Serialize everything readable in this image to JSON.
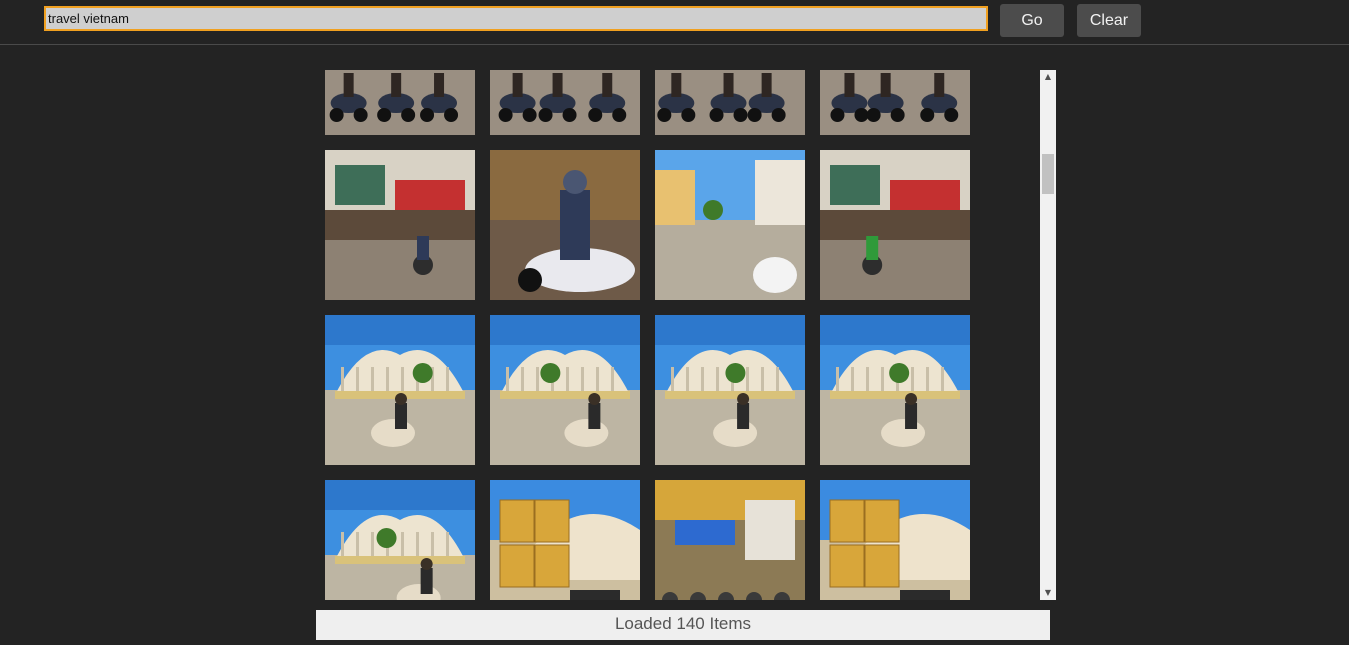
{
  "search": {
    "value": "travel vietnam"
  },
  "toolbar": {
    "go_label": "Go",
    "clear_label": "Clear"
  },
  "gallery": {
    "columns": 4,
    "rows": [
      [
        "street-scooters",
        "street-scooters",
        "street-scooters",
        "street-scooters"
      ],
      [
        "shop-street",
        "scooter-rider-closeup",
        "street-intersection",
        "shop-street-riders"
      ],
      [
        "dong-xuan-market",
        "dong-xuan-market",
        "dong-xuan-market",
        "dong-xuan-market"
      ],
      [
        "dong-xuan-market",
        "cardboard-boxes",
        "street-buildings",
        "cardboard-boxes"
      ]
    ]
  },
  "status": {
    "text": "Loaded 140 Items"
  }
}
